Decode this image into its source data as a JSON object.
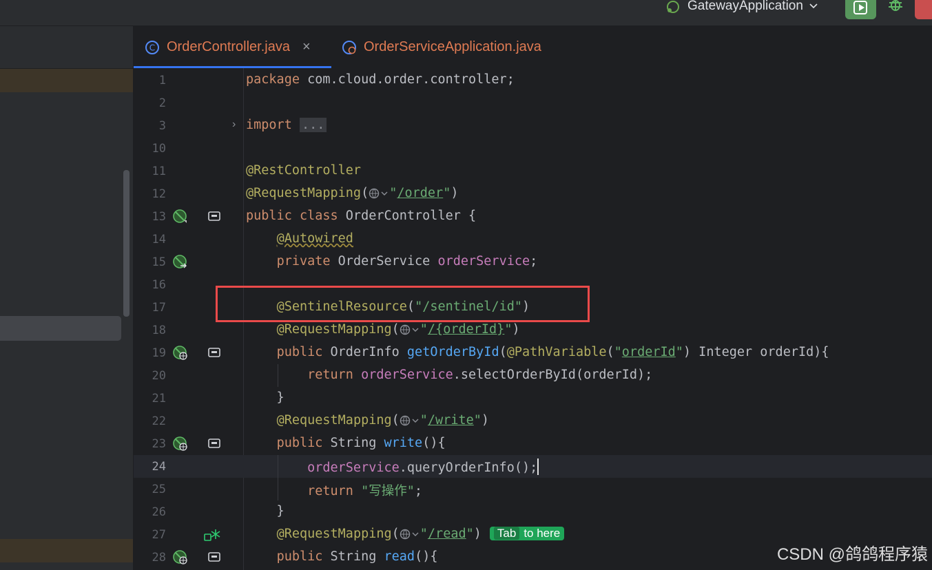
{
  "toolbar": {
    "run_config": "GatewayApplication",
    "colors": {
      "run": "#57965c",
      "stop": "#c94f4f",
      "debug": "#5fb865"
    }
  },
  "tabs": [
    {
      "label": "OrderControllerjava",
      "display": "OrderController.java",
      "active": true,
      "closable": true,
      "icon": "class-icon"
    },
    {
      "label": "OrderServiceApplication.java",
      "active": false,
      "icon": "spring-app-icon"
    }
  ],
  "editor": {
    "current_line": "24",
    "lines": [
      {
        "n": "1",
        "code": "package com.cloud.order.controller;"
      },
      {
        "n": "2",
        "code": ""
      },
      {
        "n": "3",
        "code": "import ..."
      },
      {
        "n": "10",
        "code": ""
      },
      {
        "n": "11",
        "code": "@RestController"
      },
      {
        "n": "12",
        "code": "@RequestMapping(\"/order\")"
      },
      {
        "n": "13",
        "code": "public class OrderController {"
      },
      {
        "n": "14",
        "code": "    @Autowired"
      },
      {
        "n": "15",
        "code": "    private OrderService orderService;"
      },
      {
        "n": "16",
        "code": ""
      },
      {
        "n": "17",
        "code": "    @SentinelResource(\"/sentinel/id\")"
      },
      {
        "n": "18",
        "code": "    @RequestMapping(\"/{orderId}\")"
      },
      {
        "n": "19",
        "code": "    public OrderInfo getOrderById(@PathVariable(\"orderId\") Integer orderId){"
      },
      {
        "n": "20",
        "code": "        return orderService.selectOrderById(orderId);"
      },
      {
        "n": "21",
        "code": "    }"
      },
      {
        "n": "22",
        "code": "    @RequestMapping(\"/write\")"
      },
      {
        "n": "23",
        "code": "    public String write(){"
      },
      {
        "n": "24",
        "code": "        orderService.queryOrderInfo();"
      },
      {
        "n": "25",
        "code": "        return \"写操作\";"
      },
      {
        "n": "26",
        "code": "    }"
      },
      {
        "n": "27",
        "code": "    @RequestMapping(\"/read\")"
      },
      {
        "n": "28",
        "code": "    public String read(){"
      }
    ],
    "tab_hint": {
      "key": "Tab",
      "text": "to here"
    }
  },
  "watermark": "CSDN @鸽鸽程序猿"
}
